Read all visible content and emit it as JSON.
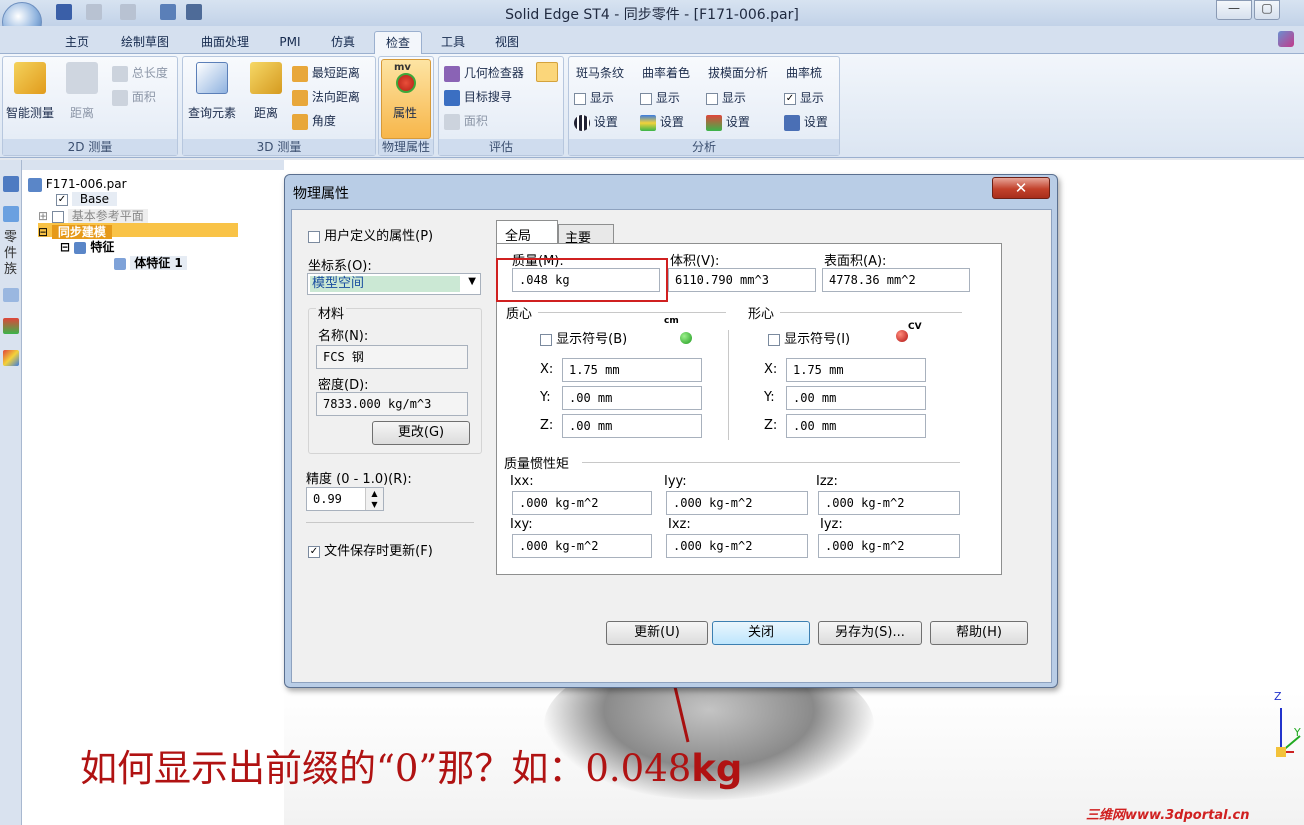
{
  "window": {
    "title": "Solid Edge ST4 - 同步零件 - [F171-006.par]"
  },
  "tabs": [
    "主页",
    "绘制草图",
    "曲面处理",
    "PMI",
    "仿真",
    "检查",
    "工具",
    "视图"
  ],
  "active_tab": "检查",
  "ribbon": {
    "g2d": {
      "label": "2D 测量",
      "smart": "智能测量",
      "distance": "距离",
      "total_length": "总长度",
      "area": "面积"
    },
    "g3d": {
      "label": "3D 测量",
      "query": "查询元素",
      "distance": "距离",
      "min_dist": "最短距离",
      "normal_dist": "法向距离",
      "angle": "角度"
    },
    "gphys": {
      "label": "物理属性",
      "props": "属性",
      "icon_text": "mv"
    },
    "geval": {
      "label": "评估",
      "geom_check": "几何检查器",
      "target_search": "目标搜寻",
      "area": "面积"
    },
    "ganalysis": {
      "label": "分析",
      "zebra": "斑马条纹",
      "curv_shade": "曲率着色",
      "draft": "拔模面分析",
      "curv_comb": "曲率梳",
      "show": "显示",
      "settings": "设置"
    }
  },
  "tree": {
    "file": "F171-006.par",
    "base": "Base",
    "ref_planes": "基本参考平面",
    "sync": "同步建模",
    "features": "特征",
    "body_feature": "体特征 1",
    "strip_label": "零件族"
  },
  "dialog": {
    "title": "物理属性",
    "user_defined": "用户定义的属性(P)",
    "coord_label": "坐标系(O):",
    "coord_value": "模型空间",
    "material_group": "材料",
    "name_label": "名称(N):",
    "name_value": "FCS 钢",
    "density_label": "密度(D):",
    "density_value": "7833.000 kg/m^3",
    "change_btn": "更改(G)",
    "accuracy_label": "精度 (0 - 1.0)(R):",
    "accuracy_value": "0.99",
    "update_on_save": "文件保存时更新(F)",
    "tabs": [
      "全局",
      "主要"
    ],
    "mass_label": "质量(M):",
    "mass_value": ".048 kg",
    "volume_label": "体积(V):",
    "volume_value": "6110.790 mm^3",
    "surface_label": "表面积(A):",
    "surface_value": "4778.36 mm^2",
    "com_label": "质心",
    "centroid_label": "形心",
    "show_symbol_b": "显示符号(B)",
    "show_symbol_i": "显示符号(I)",
    "cm_text": "cm",
    "cv_text": "CV",
    "x_label": "X:",
    "y_label": "Y:",
    "z_label": "Z:",
    "com": {
      "x": "1.75 mm",
      "y": ".00 mm",
      "z": ".00 mm"
    },
    "centroid": {
      "x": "1.75 mm",
      "y": ".00 mm",
      "z": ".00 mm"
    },
    "inertia_label": "质量惯性矩",
    "inertia": [
      {
        "label": "Ixx:",
        "value": ".000 kg-m^2"
      },
      {
        "label": "Iyy:",
        "value": ".000 kg-m^2"
      },
      {
        "label": "Izz:",
        "value": ".000 kg-m^2"
      },
      {
        "label": "Ixy:",
        "value": ".000 kg-m^2"
      },
      {
        "label": "Ixz:",
        "value": ".000 kg-m^2"
      },
      {
        "label": "Iyz:",
        "value": ".000 kg-m^2"
      }
    ],
    "buttons": {
      "update": "更新(U)",
      "close": "关闭",
      "save_as": "另存为(S)...",
      "help": "帮助(H)"
    }
  },
  "annotation": {
    "prefix": "如何显示出前缀的“0”那？如：0.048",
    "suffix": "kg"
  },
  "watermark": "三维网www.3dportal.cn",
  "axes": {
    "z": "Z",
    "y": "Y"
  },
  "colors": {
    "accent_red": "#b01212",
    "ribbon_blue": "#d5e0ef"
  }
}
